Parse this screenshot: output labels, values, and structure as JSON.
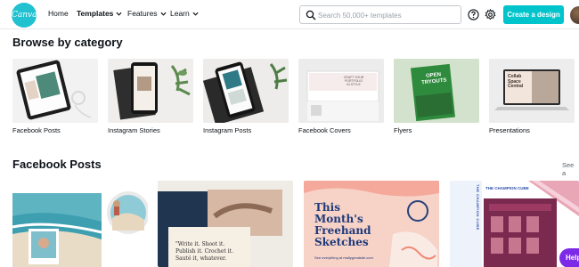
{
  "header": {
    "logo_text": "Canva",
    "nav": [
      {
        "label": "Home"
      },
      {
        "label": "Templates"
      },
      {
        "label": "Features"
      },
      {
        "label": "Learn"
      }
    ],
    "search_placeholder": "Search 50,000+ templates",
    "create_label": "Create a design"
  },
  "browse": {
    "title": "Browse by category",
    "categories": [
      {
        "label": "Facebook Posts"
      },
      {
        "label": "Instagram Stories"
      },
      {
        "label": "Instagram Posts"
      },
      {
        "label": "Facebook Covers",
        "thumb_text": "CRAFT YOUR\nPORTFOLIO\nIN STYLE"
      },
      {
        "label": "Flyers",
        "thumb_text": "OPEN\nTRYOUTS"
      },
      {
        "label": "Presentations",
        "thumb_text": "Collab\nSpace\nCentral"
      }
    ]
  },
  "posts": {
    "title": "Facebook Posts",
    "see_all": "See a",
    "cards": [
      {
        "name": "beach",
        "text": ""
      },
      {
        "name": "write",
        "text": "\"Write it. Shoot it.\nPublish it. Crochet it.\nSauté it, whatever."
      },
      {
        "name": "sketches",
        "text": "This\nMonth's\nFreehand\nSketches",
        "sub": "See everything at reallygreatsite.com"
      },
      {
        "name": "champion",
        "text": "THE CHAMPION CUBE"
      }
    ]
  },
  "help_label": "Help",
  "colors": {
    "accent": "#00c4cc",
    "logo": "#21c1d0",
    "help": "#7d2ae8",
    "sketch_title": "#1f3a7a",
    "sketch_bg": "#f7d4c9"
  }
}
